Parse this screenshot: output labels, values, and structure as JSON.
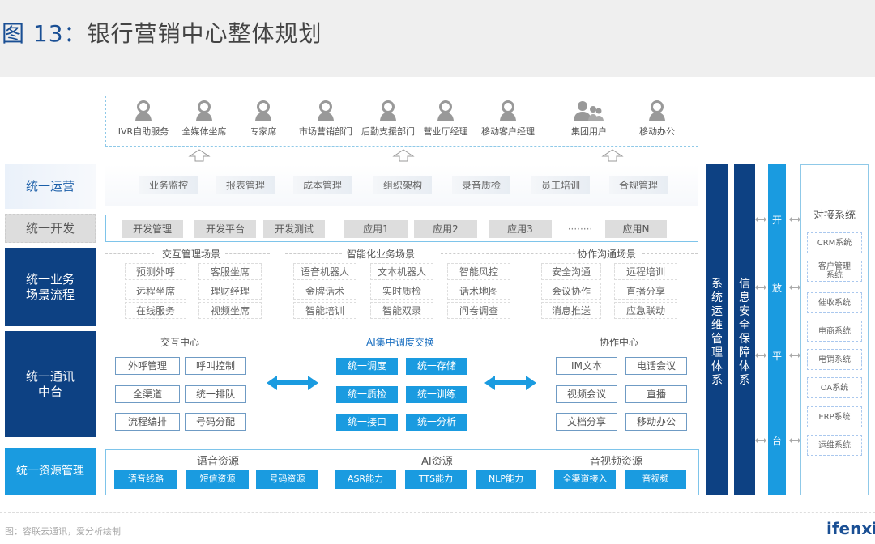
{
  "header": {
    "figure_label": "图 13：",
    "title": "银行营销中心整体规划"
  },
  "users": [
    {
      "label": "IVR自助服务",
      "icon": "person-icon"
    },
    {
      "label": "全媒体坐席",
      "icon": "person-icon"
    },
    {
      "label": "专家席",
      "icon": "person-icon"
    },
    {
      "label": "市场营销部门",
      "icon": "person-icon"
    },
    {
      "label": "后勤支援部门",
      "icon": "person-icon"
    },
    {
      "label": "营业厅经理",
      "icon": "person-icon"
    },
    {
      "label": "移动客户经理",
      "icon": "person-icon"
    },
    {
      "label": "集团用户",
      "icon": "group-icon"
    },
    {
      "label": "移动办公",
      "icon": "person-icon"
    }
  ],
  "layers": {
    "ops": {
      "label": "统一运营",
      "items": [
        "业务监控",
        "报表管理",
        "成本管理",
        "组织架构",
        "录音质检",
        "员工培训",
        "合规管理"
      ]
    },
    "dev": {
      "label": "统一开发",
      "items": [
        "开发管理",
        "开发平台",
        "开发测试",
        "应用1",
        "应用2",
        "应用3",
        "········",
        "应用N"
      ]
    },
    "scene": {
      "label_line1": "统一业务",
      "label_line2": "场景流程",
      "groups": [
        {
          "title": "交互管理场景",
          "items": [
            "预测外呼",
            "客服坐席",
            "远程坐席",
            "理财经理",
            "在线服务",
            "视频坐席"
          ]
        },
        {
          "title": "智能化业务场景",
          "items": [
            "语音机器人",
            "文本机器人",
            "智能风控",
            "金牌话术",
            "实时质检",
            "话术地图",
            "智能培训",
            "智能双录",
            "问卷调查"
          ]
        },
        {
          "title": "协作沟通场景",
          "items": [
            "安全沟通",
            "远程培训",
            "会议协作",
            "直播分享",
            "消息推送",
            "应急联动"
          ]
        }
      ]
    },
    "comm": {
      "label_line1": "统一通讯",
      "label_line2": "中台",
      "interaction": {
        "title": "交互中心",
        "items": [
          "外呼管理",
          "呼叫控制",
          "全渠道",
          "统一排队",
          "流程编排",
          "号码分配"
        ]
      },
      "ai": {
        "title": "AI集中调度交换",
        "items": [
          "统一调度",
          "统一存储",
          "统一质检",
          "统一训练",
          "统一接口",
          "统一分析"
        ]
      },
      "collab": {
        "title": "协作中心",
        "items": [
          "IM文本",
          "电话会议",
          "视频会议",
          "直播",
          "文档分享",
          "移动办公"
        ]
      }
    },
    "resource": {
      "label": "统一资源管理",
      "groups": [
        {
          "title": "语音资源",
          "items": [
            "语音线路",
            "短信资源",
            "号码资源"
          ]
        },
        {
          "title": "AI资源",
          "items": [
            "ASR能力",
            "TTS能力",
            "NLP能力"
          ]
        },
        {
          "title": "音视频资源",
          "items": [
            "全渠道接入",
            "音视频"
          ]
        }
      ]
    }
  },
  "side": {
    "ops_system": "系统运维管理体系",
    "security": "信息安全保障体系",
    "open_platform": [
      "开",
      "放",
      "平",
      "台"
    ],
    "docking": {
      "title": "对接系统",
      "items": [
        "CRM系统",
        "客户管理系统",
        "催收系统",
        "电商系统",
        "电销系统",
        "OA系统",
        "ERP系统",
        "运维系统"
      ]
    }
  },
  "colors": {
    "dark_blue": "#0d4183",
    "mid_blue": "#1a9be0",
    "light_border": "#8fc9e8"
  },
  "footer": {
    "source": "图：容联云通讯，爱分析绘制",
    "logo": "ifenxi"
  }
}
